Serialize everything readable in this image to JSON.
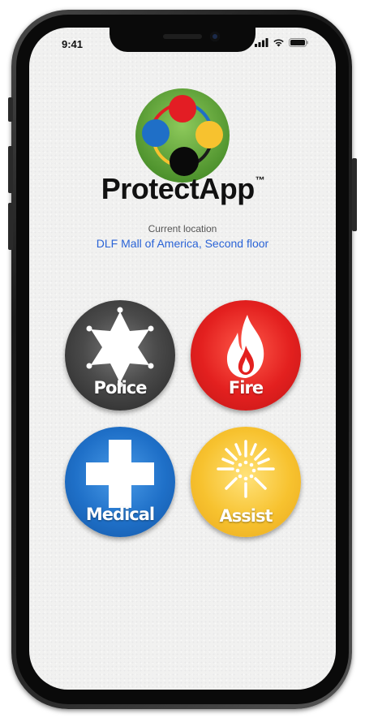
{
  "status_bar": {
    "time": "9:41",
    "icons": [
      "signal-icon",
      "wifi-icon",
      "battery-icon"
    ]
  },
  "app": {
    "name": "ProtectApp",
    "trademark": "™",
    "logo_colors": {
      "ring": "#5aa33a",
      "red": "#e31d24",
      "blue": "#1f6fc7",
      "yellow": "#f7c22f",
      "black": "#0a0a0a"
    }
  },
  "location": {
    "label": "Current location",
    "value": "DLF Mall of America, Second floor",
    "value_color": "#2a63d6"
  },
  "buttons": [
    {
      "id": "police",
      "label": "Police",
      "icon": "sheriff-star-icon",
      "color": "#4a4a4a"
    },
    {
      "id": "fire",
      "label": "Fire",
      "icon": "flame-icon",
      "color": "#e3201f"
    },
    {
      "id": "medical",
      "label": "Medical",
      "icon": "medical-cross-icon",
      "color": "#1f70c8"
    },
    {
      "id": "assist",
      "label": "Assist",
      "icon": "burst-icon",
      "color": "#f7c22f"
    }
  ]
}
